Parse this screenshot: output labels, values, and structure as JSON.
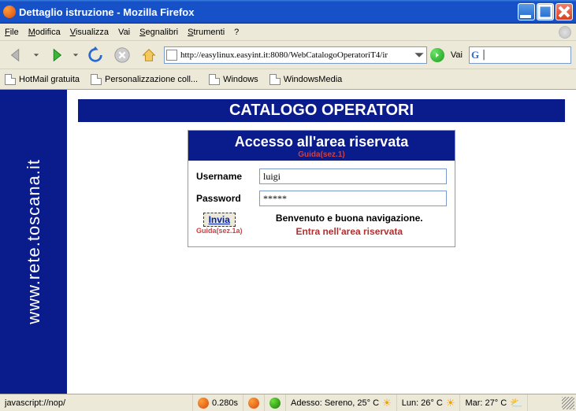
{
  "window": {
    "title": "Dettaglio istruzione - Mozilla Firefox"
  },
  "menu": {
    "file": "File",
    "modifica": "Modifica",
    "visualizza": "Visualizza",
    "vai": "Vai",
    "segnalibri": "Segnalibri",
    "strumenti": "Strumenti",
    "help": "?"
  },
  "toolbar": {
    "url": "http://easylinux.easyint.it:8080/WebCatalogoOperatoriT4/ir",
    "go_label": "Vai",
    "search_value": ""
  },
  "bookmarks": {
    "b0": "HotMail gratuita",
    "b1": "Personalizzazione coll...",
    "b2": "Windows",
    "b3": "WindowsMedia"
  },
  "page": {
    "sidebar": "www.rete.toscana.it",
    "banner": "CATALOGO OPERATORI",
    "login_title": "Accesso all'area riservata",
    "login_guide": "Guida(sez.1)",
    "username_label": "Username",
    "username_value": "luigi",
    "password_label": "Password",
    "password_value": "*****",
    "submit_label": "Invia",
    "submit_guide": "Guida(sez.1a)",
    "welcome_line1": "Benvenuto e buona navigazione.",
    "welcome_line2": "Entra nell'area riservata"
  },
  "status": {
    "left": "javascript://nop/",
    "time": "0.280s",
    "weather_now": "Adesso: Sereno, 25° C",
    "weather_mon": "Lun: 26° C",
    "weather_tue": "Mar: 27° C"
  }
}
